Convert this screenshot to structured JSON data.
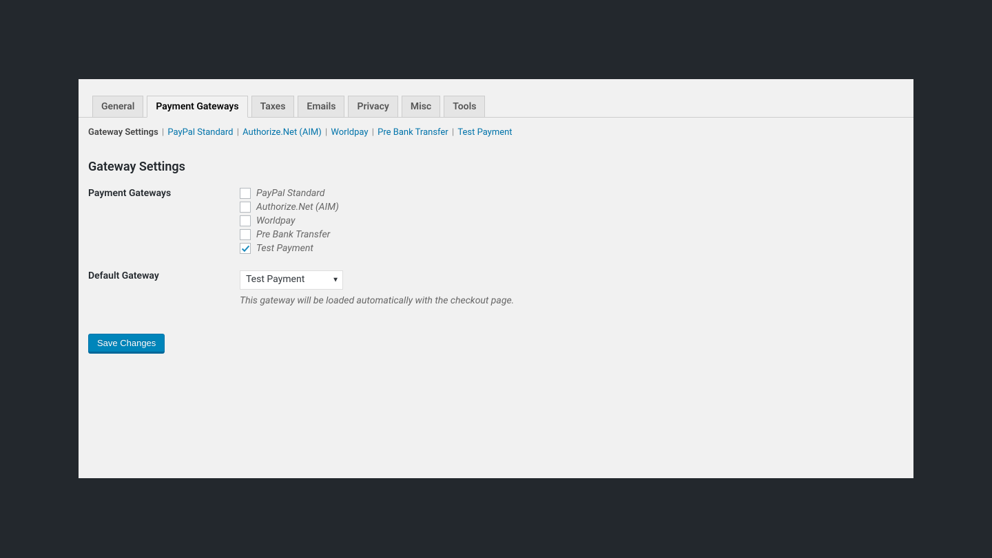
{
  "tabs": [
    {
      "label": "General",
      "active": false
    },
    {
      "label": "Payment Gateways",
      "active": true
    },
    {
      "label": "Taxes",
      "active": false
    },
    {
      "label": "Emails",
      "active": false
    },
    {
      "label": "Privacy",
      "active": false
    },
    {
      "label": "Misc",
      "active": false
    },
    {
      "label": "Tools",
      "active": false
    }
  ],
  "subnav": [
    {
      "label": "Gateway Settings",
      "current": true
    },
    {
      "label": "PayPal Standard",
      "current": false
    },
    {
      "label": "Authorize.Net (AIM)",
      "current": false
    },
    {
      "label": "Worldpay",
      "current": false
    },
    {
      "label": "Pre Bank Transfer",
      "current": false
    },
    {
      "label": "Test Payment",
      "current": false
    }
  ],
  "heading": "Gateway Settings",
  "form": {
    "gateways_label": "Payment Gateways",
    "gateways": [
      {
        "label": "PayPal Standard",
        "checked": false
      },
      {
        "label": "Authorize.Net (AIM)",
        "checked": false
      },
      {
        "label": "Worldpay",
        "checked": false
      },
      {
        "label": "Pre Bank Transfer",
        "checked": false
      },
      {
        "label": "Test Payment",
        "checked": true
      }
    ],
    "default_gateway_label": "Default Gateway",
    "default_gateway_value": "Test Payment",
    "default_gateway_description": "This gateway will be loaded automatically with the checkout page."
  },
  "save_button": "Save Changes"
}
